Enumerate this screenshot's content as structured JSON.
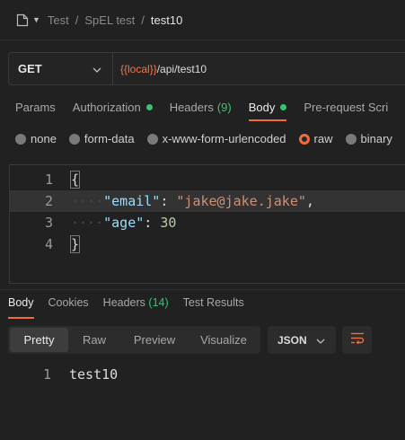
{
  "breadcrumb": {
    "items": [
      "Test",
      "SpEL test"
    ],
    "separator": "/",
    "current": "test10"
  },
  "request": {
    "method": "GET",
    "url_variable": "{{local}}",
    "url_path": "/api/test10"
  },
  "tabs": [
    {
      "label": "Params"
    },
    {
      "label": "Authorization",
      "dot": true
    },
    {
      "label": "Headers",
      "count": "(9)"
    },
    {
      "label": "Body",
      "dot": true,
      "active": true
    },
    {
      "label": "Pre-request Scri"
    }
  ],
  "body_modes": [
    {
      "label": "none"
    },
    {
      "label": "form-data"
    },
    {
      "label": "x-www-form-urlencoded"
    },
    {
      "label": "raw",
      "selected": true
    },
    {
      "label": "binary"
    }
  ],
  "editor": {
    "line_numbers": [
      "1",
      "2",
      "3",
      "4"
    ],
    "open_brace": "{",
    "close_brace": "}",
    "key1": "\"email\"",
    "colon": ": ",
    "value1": "\"jake@jake.jake\"",
    "comma": ",",
    "key2": "\"age\"",
    "value2": "30",
    "indent_dots": "····"
  },
  "response": {
    "tabs": [
      {
        "label": "Body",
        "active": true
      },
      {
        "label": "Cookies"
      },
      {
        "label": "Headers",
        "count": "(14)"
      },
      {
        "label": "Test Results"
      }
    ],
    "views": [
      "Pretty",
      "Raw",
      "Preview",
      "Visualize"
    ],
    "active_view": "Pretty",
    "format": "JSON",
    "line_number": "1",
    "body": "test10"
  },
  "colors": {
    "accent": "#f26b3a",
    "green": "#3ac273",
    "background": "#212121"
  },
  "icons": [
    "document-icon",
    "caret-down-icon",
    "chevron-down-icon",
    "wrap-lines-icon"
  ]
}
